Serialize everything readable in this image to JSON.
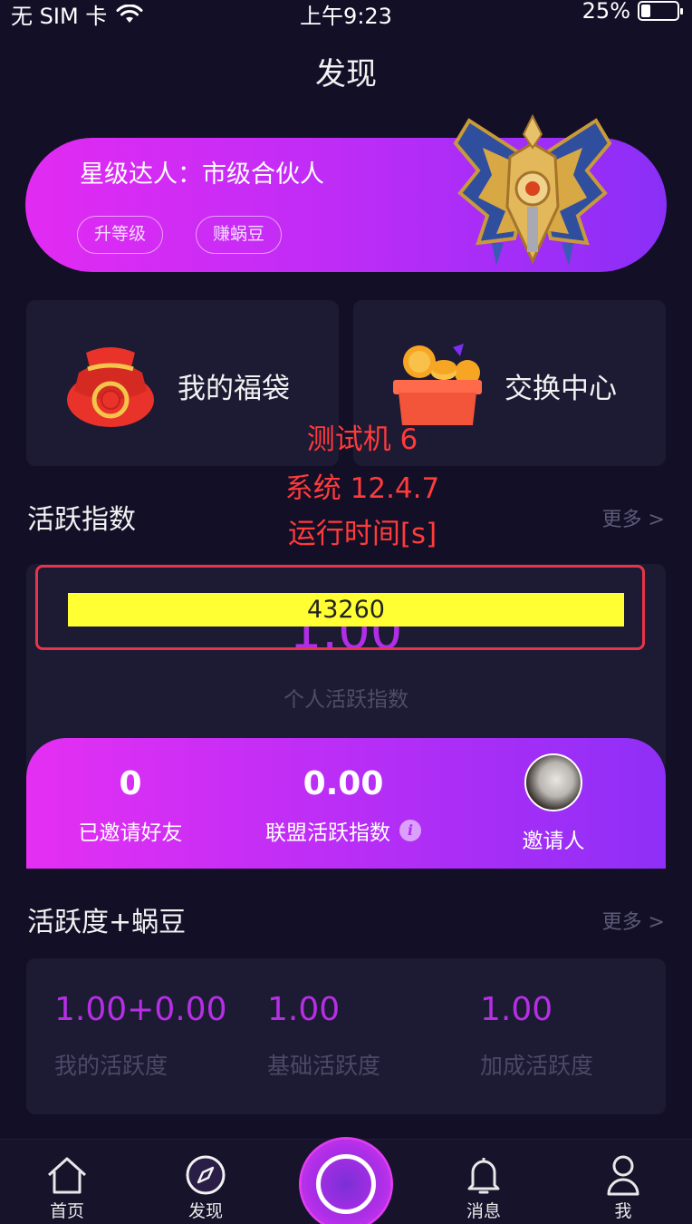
{
  "status_bar": {
    "carrier": "无 SIM 卡",
    "time": "上午9:23",
    "battery": "25%",
    "battery_level": 0.25
  },
  "nav": {
    "title": "发现"
  },
  "level_banner": {
    "title": "星级达人：市级合伙人",
    "upgrade_label": "升等级",
    "earn_label": "赚蜗豆"
  },
  "cards": {
    "lucky_bag": "我的福袋",
    "exchange": "交换中心"
  },
  "overlay": {
    "line1": "测试机 6",
    "line2": "系统 12.4.7",
    "line3": "运行时间[s]",
    "runtime": "43260"
  },
  "activity": {
    "title": "活跃指数",
    "more": "更多 >",
    "personal_value": "1.00",
    "personal_label": "个人活跃指数",
    "invited_value": "0",
    "invited_label": "已邀请好友",
    "alliance_value": "0.00",
    "alliance_label": "联盟活跃指数",
    "info_glyph": "i",
    "inviter_label": "邀请人"
  },
  "activity_bean": {
    "title": "活跃度+蜗豆",
    "more": "更多 >",
    "items": [
      {
        "value": "1.00+0.00",
        "label": "我的活跃度"
      },
      {
        "value": "1.00",
        "label": "基础活跃度"
      },
      {
        "value": "1.00",
        "label": "加成活跃度"
      }
    ]
  },
  "tabbar": {
    "home": "首页",
    "discover": "发现",
    "messages": "消息",
    "me": "我"
  },
  "colors": {
    "background": "#120f27",
    "card": "#1d1a33",
    "accent": "#b62fe5",
    "overlay_red": "#ff3b3b",
    "runtime_bg": "#ffff33"
  }
}
